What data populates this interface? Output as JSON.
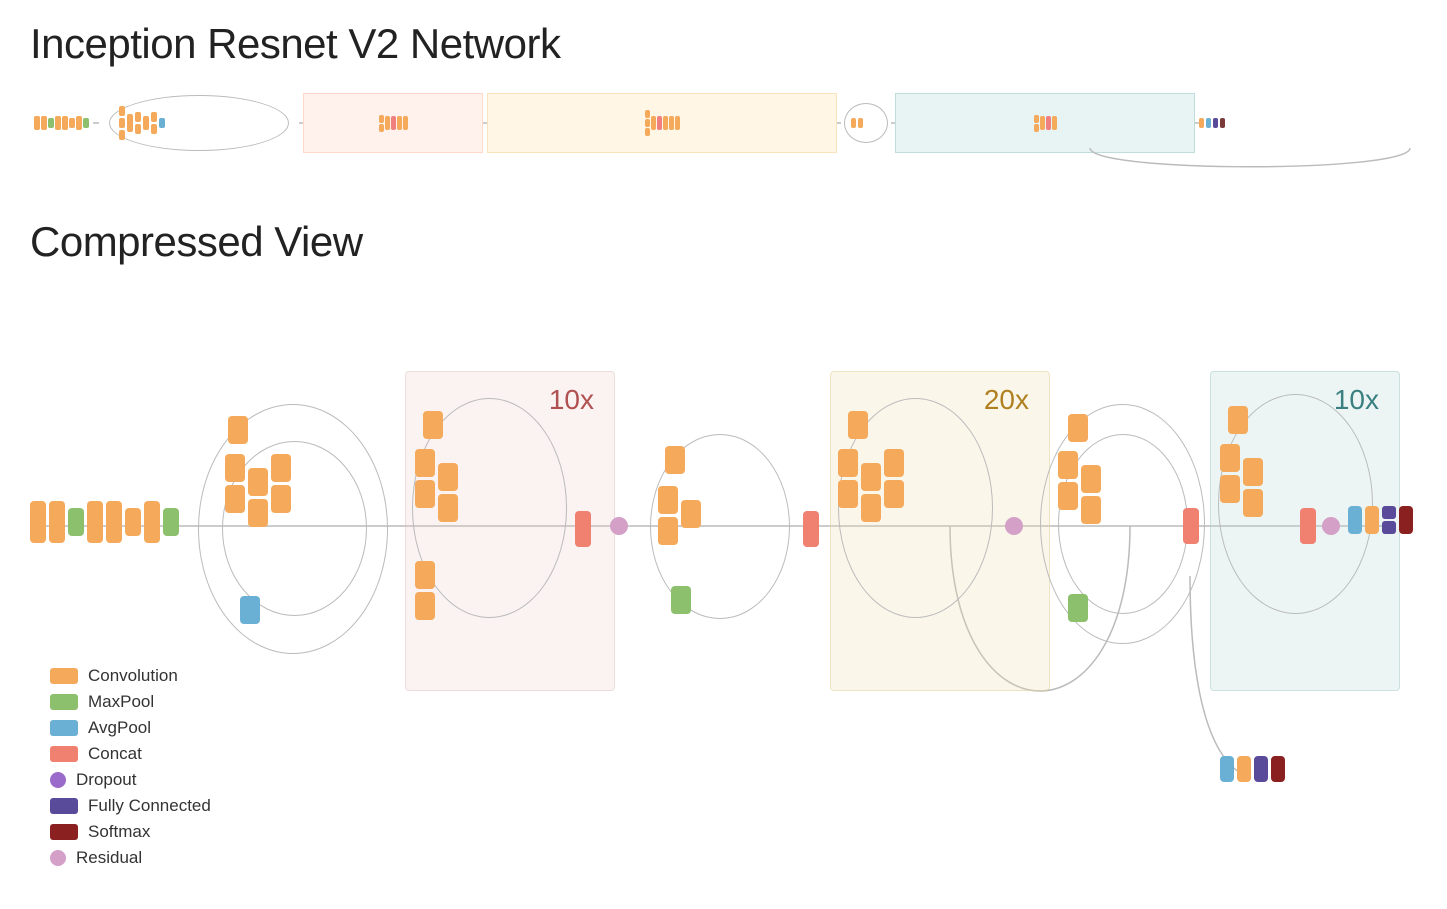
{
  "page": {
    "title": "Inception Resnet V2 Network",
    "compressed_title": "Compressed View"
  },
  "repeat_labels": {
    "block1": "10x",
    "block2": "20x",
    "block3": "10x"
  },
  "legend": [
    {
      "label": "Convolution",
      "type": "swatch",
      "color": "#f5a95a"
    },
    {
      "label": "MaxPool",
      "type": "swatch",
      "color": "#8dc06c"
    },
    {
      "label": "AvgPool",
      "type": "swatch",
      "color": "#6ab0d4"
    },
    {
      "label": "Concat",
      "type": "swatch",
      "color": "#f08070"
    },
    {
      "label": "Dropout",
      "type": "dot",
      "color": "#9b6bcc"
    },
    {
      "label": "Fully Connected",
      "type": "swatch",
      "color": "#5a4a9a"
    },
    {
      "label": "Softmax",
      "type": "swatch",
      "color": "#8b2020"
    },
    {
      "label": "Residual",
      "type": "dot",
      "color": "#d4a0c8"
    }
  ]
}
